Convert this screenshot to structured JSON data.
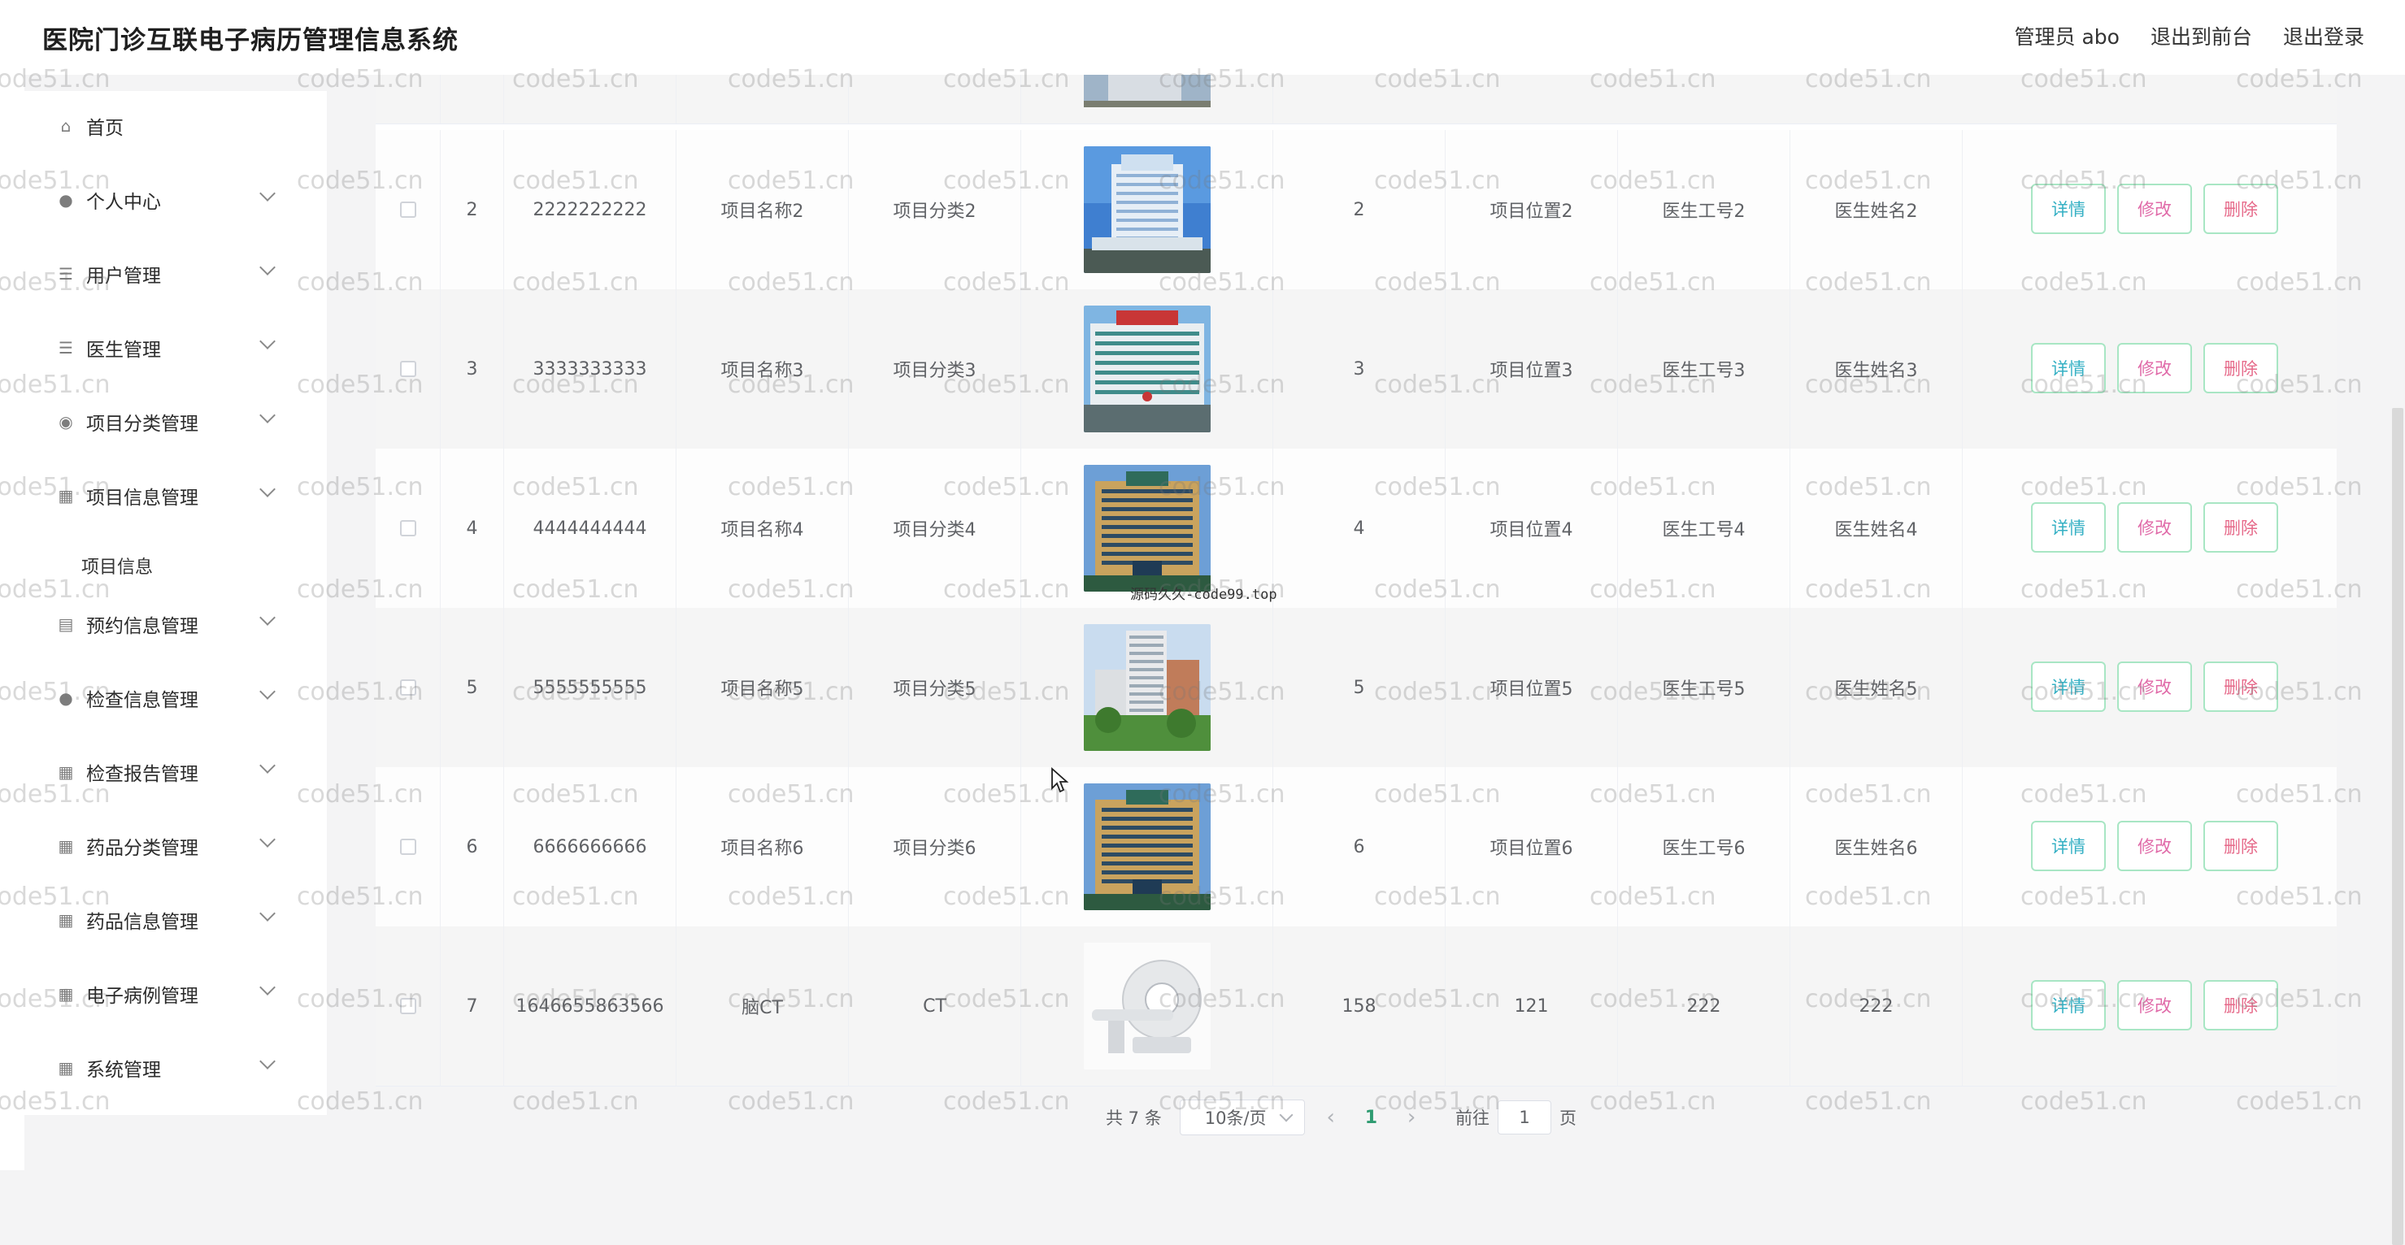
{
  "header": {
    "title": "医院门诊互联电子病历管理信息系统",
    "links": [
      "管理员 abo",
      "退出到前台",
      "退出登录"
    ]
  },
  "sidebar": {
    "items": [
      {
        "label": "首页",
        "icon": "home-icon",
        "expandable": false
      },
      {
        "label": "个人中心",
        "icon": "user-icon",
        "expandable": true
      },
      {
        "label": "用户管理",
        "icon": "sliders-icon",
        "expandable": true
      },
      {
        "label": "医生管理",
        "icon": "list-icon",
        "expandable": true
      },
      {
        "label": "项目分类管理",
        "icon": "location-icon",
        "expandable": true
      },
      {
        "label": "项目信息管理",
        "icon": "grid-icon",
        "expandable": true
      },
      {
        "label": "预约信息管理",
        "icon": "calendar-icon",
        "expandable": true
      },
      {
        "label": "检查信息管理",
        "icon": "user-icon",
        "expandable": true
      },
      {
        "label": "检查报告管理",
        "icon": "apps-icon",
        "expandable": true
      },
      {
        "label": "药品分类管理",
        "icon": "grid-icon",
        "expandable": true
      },
      {
        "label": "药品信息管理",
        "icon": "grid-icon",
        "expandable": true
      },
      {
        "label": "电子病例管理",
        "icon": "grid-icon",
        "expandable": true
      },
      {
        "label": "系统管理",
        "icon": "grid-icon",
        "expandable": true
      }
    ],
    "sub_item": "项目信息"
  },
  "table": {
    "rows": [
      {
        "index": "2",
        "code": "2222222222",
        "name": "项目名称2",
        "category": "项目分类2",
        "image": "hospital-building-blue",
        "count": "2",
        "location": "项目位置2",
        "doctor_no": "医生工号2",
        "doctor_name": "医生姓名2"
      },
      {
        "index": "3",
        "code": "3333333333",
        "name": "项目名称3",
        "category": "项目分类3",
        "image": "hospital-building-red-sign",
        "count": "3",
        "location": "项目位置3",
        "doctor_no": "医生工号3",
        "doctor_name": "医生姓名3"
      },
      {
        "index": "4",
        "code": "4444444444",
        "name": "项目名称4",
        "category": "项目分类4",
        "image": "hospital-building-yellow",
        "count": "4",
        "location": "项目位置4",
        "doctor_no": "医生工号4",
        "doctor_name": "医生姓名4"
      },
      {
        "index": "5",
        "code": "5555555555",
        "name": "项目名称5",
        "category": "项目分类5",
        "image": "hospital-tower-trees",
        "count": "5",
        "location": "项目位置5",
        "doctor_no": "医生工号5",
        "doctor_name": "医生姓名5"
      },
      {
        "index": "6",
        "code": "6666666666",
        "name": "项目名称6",
        "category": "项目分类6",
        "image": "hospital-building-yellow",
        "count": "6",
        "location": "项目位置6",
        "doctor_no": "医生工号6",
        "doctor_name": "医生姓名6"
      },
      {
        "index": "7",
        "code": "1646655863566",
        "name": "脑CT",
        "category": "CT",
        "image": "ct-scanner",
        "count": "158",
        "location": "121",
        "doctor_no": "222",
        "doctor_name": "222"
      }
    ],
    "actions": {
      "detail": "详情",
      "edit": "修改",
      "delete": "删除"
    }
  },
  "pagination": {
    "total": "共 7 条",
    "page_size": "10条/页",
    "current_page": "1",
    "goto_label": "前往",
    "goto_value": "1",
    "goto_unit": "页"
  },
  "watermark": {
    "text": "code51.cn"
  },
  "overlay_text": "源码久久-code99.top",
  "colors": {
    "accent": "#2e9b71",
    "detail": "#35b0c4",
    "edit": "#e06aa8",
    "delete": "#e66a8a",
    "button_border": "#a8e6c4"
  }
}
